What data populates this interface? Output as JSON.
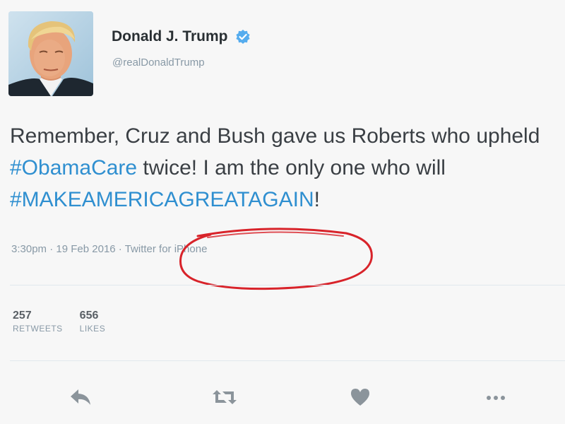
{
  "user": {
    "display_name": "Donald J. Trump",
    "handle": "@realDonaldTrump",
    "verified": true
  },
  "tweet": {
    "text_parts": [
      {
        "text": "Remember, Cruz and Bush gave us Roberts who upheld ",
        "type": "text"
      },
      {
        "text": "#ObamaCare",
        "type": "hashtag"
      },
      {
        "text": " twice! I am the only one who will ",
        "type": "text"
      },
      {
        "text": "#MAKEAMERICAGREATAGAIN",
        "type": "hashtag"
      },
      {
        "text": "!",
        "type": "text"
      }
    ],
    "time": "3:30pm",
    "separator": " · ",
    "date": "19 Feb 2016",
    "source": "Twitter for iPhone"
  },
  "stats": {
    "retweets_count": "257",
    "retweets_label": "RETWEETS",
    "likes_count": "656",
    "likes_label": "LIKES"
  },
  "actions": {
    "icons": [
      "reply-icon",
      "retweet-icon",
      "like-icon",
      "more-icon"
    ]
  },
  "colors": {
    "hashtag": "#2f8fd0",
    "verified": "#55acee",
    "annotation": "#d8232a",
    "muted": "#8899a6",
    "action_icon": "#8b949b"
  }
}
